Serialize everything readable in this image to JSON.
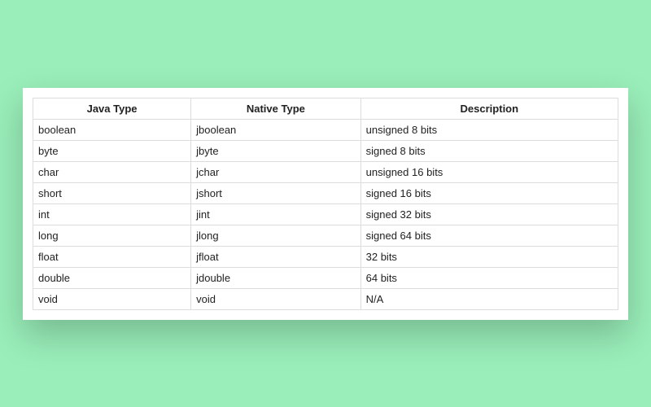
{
  "table": {
    "headers": [
      "Java Type",
      "Native Type",
      "Description"
    ],
    "rows": [
      {
        "java": "boolean",
        "native": "jboolean",
        "desc": "unsigned 8 bits"
      },
      {
        "java": "byte",
        "native": "jbyte",
        "desc": "signed 8 bits"
      },
      {
        "java": "char",
        "native": "jchar",
        "desc": "unsigned 16 bits"
      },
      {
        "java": "short",
        "native": "jshort",
        "desc": "signed 16 bits"
      },
      {
        "java": "int",
        "native": "jint",
        "desc": "signed 32 bits"
      },
      {
        "java": "long",
        "native": "jlong",
        "desc": "signed 64 bits"
      },
      {
        "java": "float",
        "native": "jfloat",
        "desc": "32 bits"
      },
      {
        "java": "double",
        "native": "jdouble",
        "desc": "64 bits"
      },
      {
        "java": "void",
        "native": "void",
        "desc": "N/A"
      }
    ]
  }
}
